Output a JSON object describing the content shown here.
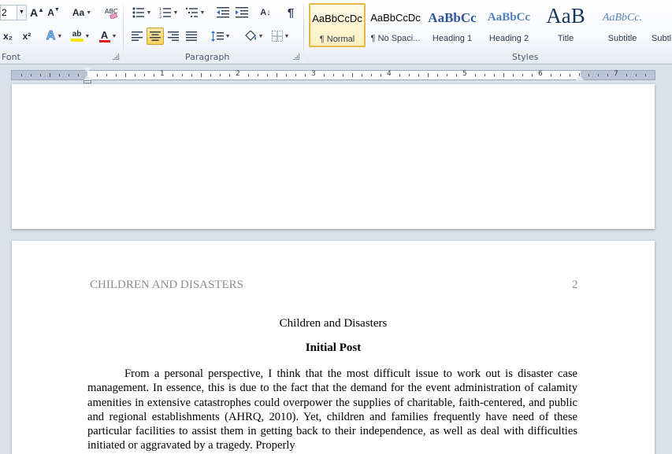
{
  "font_group": {
    "label": "Font",
    "font_size": "2",
    "grow_font": "A",
    "shrink_font": "A",
    "change_case": "Aa",
    "subscript": "x₂",
    "superscript": "x²",
    "text_effects": "A",
    "highlight": "ab",
    "font_color": "A",
    "highlight_color": "#f5e600",
    "font_color_bar": "#e02020"
  },
  "paragraph_group": {
    "label": "Paragraph",
    "show_marks": "¶",
    "sort_label": "A↓",
    "alignment_selected": "center"
  },
  "styles_group": {
    "label": "Styles",
    "items": [
      {
        "sample": "AaBbCcDc",
        "name": "¶ Normal",
        "selected": true
      },
      {
        "sample": "AaBbCcDc",
        "name": "¶ No Spaci..."
      },
      {
        "sample": "AaBbCc",
        "name": "Heading 1"
      },
      {
        "sample": "AaBbCc",
        "name": "Heading 2"
      },
      {
        "sample": "AaB",
        "name": "Title"
      },
      {
        "sample": "AaBbCc.",
        "name": "Subtitle"
      },
      {
        "sample": "",
        "name": "Subtl"
      }
    ]
  },
  "ruler": {
    "numbers": [
      "1",
      "2",
      "3",
      "4",
      "5",
      "6",
      "7"
    ]
  },
  "document": {
    "header_left": "CHILDREN AND DISASTERS",
    "page_number": "2",
    "title": "Children and Disasters",
    "subtitle": "Initial Post",
    "body": "From a personal perspective, I think that the most difficult issue to work out is disaster case management. In essence, this is due to the fact that the demand for the event administration of calamity amenities in extensive catastrophes could overpower the supplies of charitable, faith-centered, and public and regional establishments (AHRQ, 2010). Yet, children and families frequently have need of these particular facilities to assist them in getting back to their independence, as well as deal with difficulties initiated or aggravated by a tragedy. Properly"
  }
}
